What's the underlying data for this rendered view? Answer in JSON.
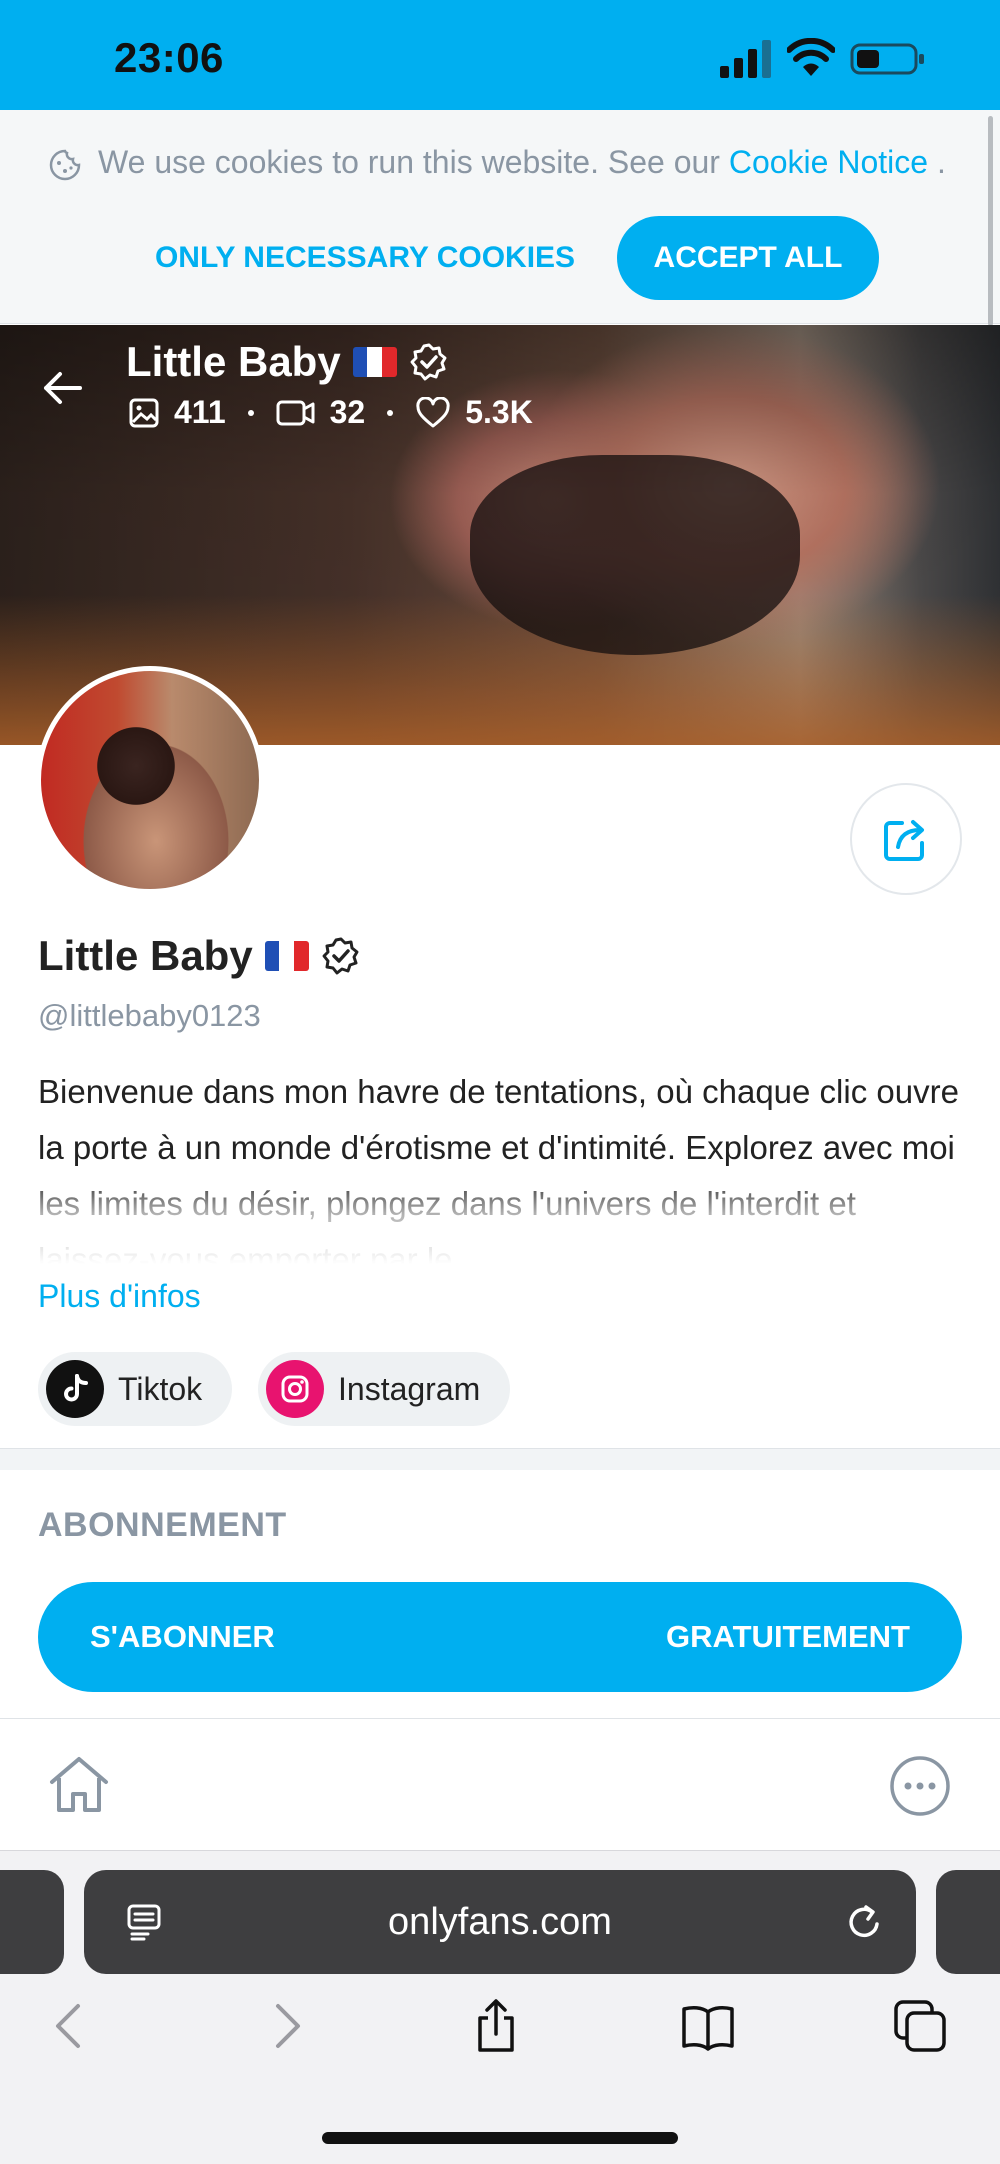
{
  "status_bar": {
    "time": "23:06"
  },
  "cookie_banner": {
    "text": "We use cookies to run this website. See our ",
    "link": "Cookie Notice",
    "suffix": " .",
    "necessary_button": "ONLY NECESSARY COOKIES",
    "accept_button": "ACCEPT ALL"
  },
  "header": {
    "name": "Little Baby",
    "stats": {
      "photos": "411",
      "videos": "32",
      "likes": "5.3K"
    }
  },
  "profile": {
    "name": "Little Baby",
    "username": "@littlebaby0123",
    "bio": "Bienvenue dans mon havre de tentations, où chaque clic ouvre la porte à un monde d'érotisme et d'intimité. Explorez avec moi les limites du désir, plongez dans l'univers de l'interdit et laissez-vous emporter par le",
    "more_info": "Plus d'infos",
    "socials": [
      {
        "label": "Tiktok",
        "icon": "tiktok-icon"
      },
      {
        "label": "Instagram",
        "icon": "instagram-icon"
      }
    ]
  },
  "subscription": {
    "section_title": "ABONNEMENT",
    "button_left": "S'ABONNER",
    "button_right": "GRATUITEMENT"
  },
  "browser": {
    "url": "onlyfans.com"
  },
  "colors": {
    "accent": "#00aff0",
    "muted": "#8a96a3",
    "instagram": "#e8136f"
  }
}
